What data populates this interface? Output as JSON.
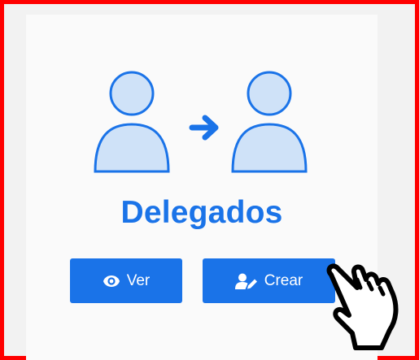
{
  "card": {
    "title": "Delegados",
    "illustration_icon": "user-transfer-icon"
  },
  "buttons": {
    "ver_label": "Ver",
    "ver_icon": "eye-icon",
    "crear_label": "Crear",
    "crear_icon": "user-edit-icon"
  },
  "cursor": {
    "icon": "pointing-hand-cursor-icon"
  },
  "colors": {
    "accent": "#1a73e8",
    "highlight_border": "#ff0000",
    "illustration_fill": "#cfe2f8"
  }
}
